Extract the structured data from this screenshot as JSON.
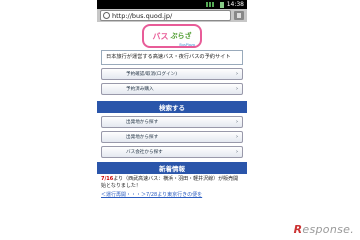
{
  "status": {
    "time": "14:38"
  },
  "browser": {
    "url": "http://bus.quod.jp/"
  },
  "logo": {
    "part1": "バス",
    "part2": "ぷらざ",
    "sub": "BusPlaza"
  },
  "intro": {
    "text": "日本旅行が運営する高速バス・夜行バスの予約サイト"
  },
  "menu": [
    {
      "label": "予約確認/取消(ログイン)"
    },
    {
      "label": "予約済み購入"
    }
  ],
  "search": {
    "title": "検索する",
    "items": [
      {
        "label": "出発地から探す"
      },
      {
        "label": "出発地から探す"
      },
      {
        "label": "バス会社から探す"
      }
    ]
  },
  "news": {
    "title": "新着情報",
    "item1_date": "7/16",
    "item1_text": "より（西武高速バス：横浜・羽田・軽井沢線）が販売開始となりました！",
    "item2_text": "＜運行再開・・・＞7/28より東京行きの便を",
    "item2_link": ""
  },
  "watermark": {
    "r": "R",
    "text": "esponse."
  }
}
